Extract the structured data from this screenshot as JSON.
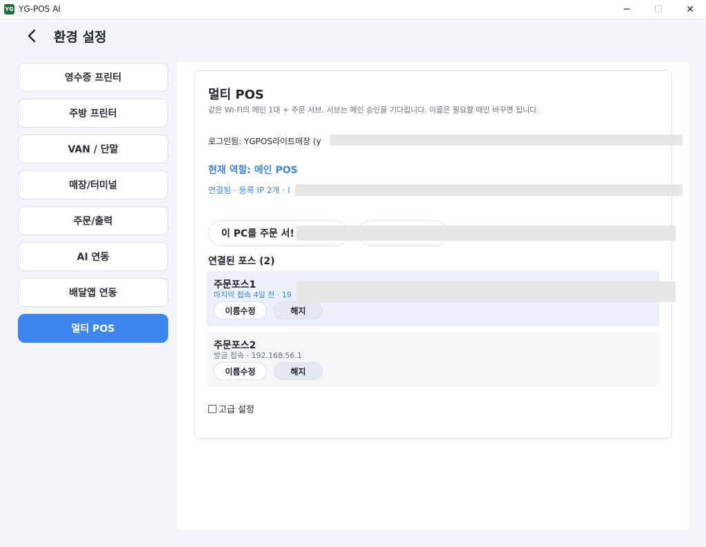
{
  "window": {
    "logo_text": "YG",
    "app_title": "YG-POS AI",
    "min_symbol": "─",
    "max_symbol": "☐",
    "close_symbol": "✕"
  },
  "header": {
    "title": "환경 설정"
  },
  "sidebar": {
    "items": [
      {
        "label": "영수증 프린터"
      },
      {
        "label": "주방 프린터"
      },
      {
        "label": "VAN / 단말"
      },
      {
        "label": "매장/터미널"
      },
      {
        "label": "주문/출력"
      },
      {
        "label": "AI 연동"
      },
      {
        "label": "배달앱 연동"
      },
      {
        "label": "멀티 POS"
      }
    ]
  },
  "multi_pos": {
    "title": "멀티 POS",
    "description": "같은 Wi-Fi의 메인 1대 + 주문 서브. 서브는 메인 승인을 기다립니다. 이름은 필요할 때만 바꾸면 됩니다.",
    "login": "로그인됨: YGPOS라이트매장 (y",
    "role": "현재 역할: 메인 POS",
    "connection": "연결됨 · 등록 IP 2개 · I",
    "button_order_server": "이 PC를 주문 서!",
    "button_second": "",
    "connected_title": "연결된 포스 (2)",
    "devices": [
      {
        "name": "주문포스1",
        "status": "마지막 접속 4일 전 · 19",
        "rename": "이름수정",
        "unlink": "해지"
      },
      {
        "name": "주문포스2",
        "status": "방금 접속 · 192.168.56.1",
        "rename": "이름수정",
        "unlink": "해지"
      }
    ],
    "advanced_label": "고급 설정"
  },
  "colors": {
    "accent": "#3d85f0",
    "logo_green": "#1f6a3a",
    "selected_row": "#eceffc"
  }
}
